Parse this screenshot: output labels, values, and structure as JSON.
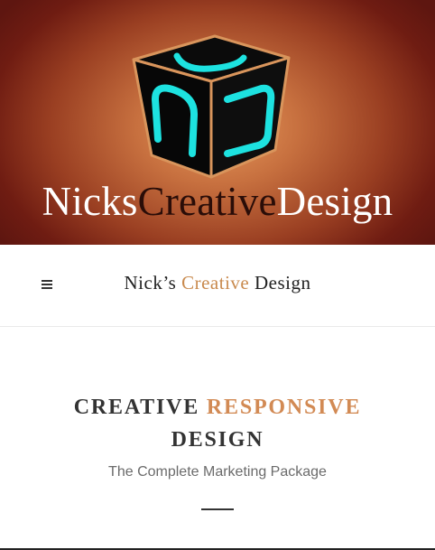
{
  "hero": {
    "logo_word_1": "Nicks",
    "logo_word_2": "Creative",
    "logo_word_3": "Design",
    "colors": {
      "cube": "#0a0a0a",
      "cube_edge": "#d9955c",
      "letters": "#1de2e0"
    }
  },
  "header": {
    "menu_icon": "hamburger-menu-icon",
    "title_part_1": "Nick’s ",
    "title_accent": "Creative",
    "title_part_2": " Design",
    "accent_color": "#c98a4e"
  },
  "main": {
    "headline_part_1": "CREATIVE ",
    "headline_accent": "RESPONSIVE",
    "headline_part_2": "DESIGN",
    "tagline": "The Complete Marketing Package"
  }
}
